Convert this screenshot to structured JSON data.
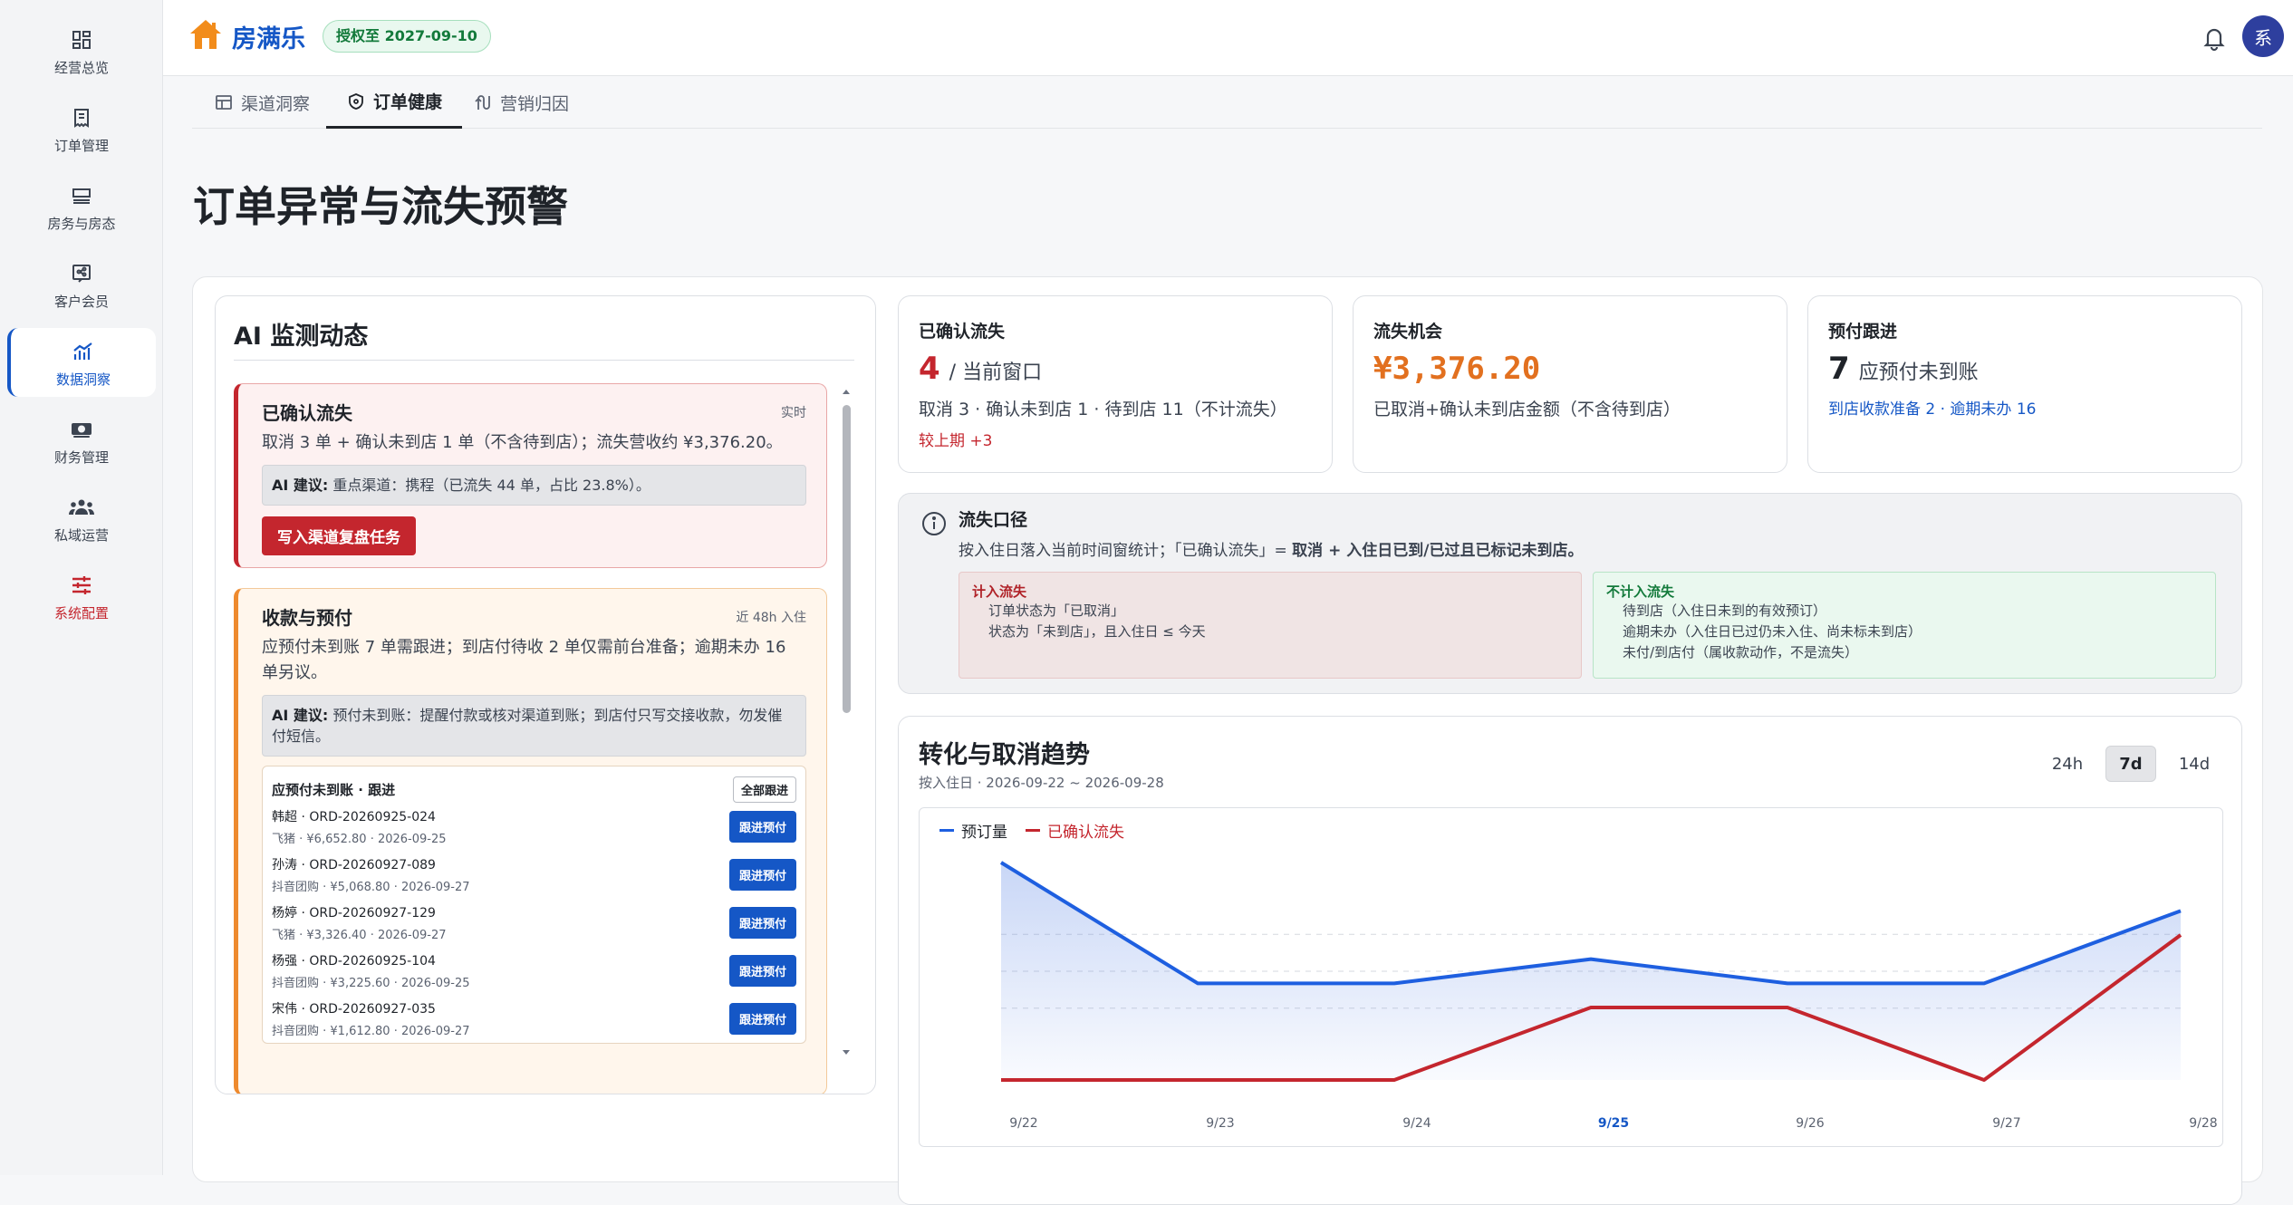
{
  "sidebar": {
    "items": [
      {
        "label": "经营总览",
        "icon": "dashboard-icon"
      },
      {
        "label": "订单管理",
        "icon": "order-icon"
      },
      {
        "label": "房务与房态",
        "icon": "room-icon"
      },
      {
        "label": "客户会员",
        "icon": "member-icon"
      },
      {
        "label": "数据洞察",
        "icon": "chart-icon"
      },
      {
        "label": "财务管理",
        "icon": "cash-icon"
      },
      {
        "label": "私域运营",
        "icon": "community-icon"
      },
      {
        "label": "系统配置",
        "icon": "settings-icon"
      }
    ],
    "active_index": 4
  },
  "header": {
    "brand": "房满乐",
    "license": "授权至 2027-09-10",
    "avatar": "系"
  },
  "tabs": [
    {
      "label": "渠道洞察"
    },
    {
      "label": "订单健康"
    },
    {
      "label": "营销归因"
    }
  ],
  "page_title": "订单异常与流失预警",
  "ai_panel": {
    "title": "AI 监测动态",
    "alerts": [
      {
        "title": "已确认流失",
        "tag": "实时",
        "body": "取消 3 单 + 确认未到店 1 单（不含待到店）；流失营收约 ¥3,376.20。",
        "suggest_label": "AI 建议:",
        "suggest": "重点渠道：携程（已流失 44 单，占比 23.8%）。",
        "action": "写入渠道复盘任务"
      },
      {
        "title": "收款与预付",
        "tag": "近 48h 入住",
        "body": "应预付未到账 7 单需跟进；到店付待收 2 单仅需前台准备；逾期未办 16 单另议。",
        "suggest_label": "AI 建议:",
        "suggest": "预付未到账：提醒付款或核对渠道到账；到店付只写交接收款，勿发催付短信。",
        "follow_title": "应预付未到账 · 跟进",
        "follow_all": "全部跟进",
        "orders": [
          {
            "name": "韩超 · ORD-20260925-024",
            "sub": "飞猪 · ¥6,652.80 · 2026-09-25",
            "action": "跟进预付"
          },
          {
            "name": "孙涛 · ORD-20260927-089",
            "sub": "抖音团购 · ¥5,068.80 · 2026-09-27",
            "action": "跟进预付"
          },
          {
            "name": "杨婷 · ORD-20260927-129",
            "sub": "飞猪 · ¥3,326.40 · 2026-09-27",
            "action": "跟进预付"
          },
          {
            "name": "杨强 · ORD-20260925-104",
            "sub": "抖音团购 · ¥3,225.60 · 2026-09-25",
            "action": "跟进预付"
          },
          {
            "name": "宋伟 · ORD-20260927-035",
            "sub": "抖音团购 · ¥1,612.80 · 2026-09-27",
            "action": "跟进预付"
          }
        ]
      }
    ]
  },
  "kpis": [
    {
      "label": "已确认流失",
      "num": "4",
      "suffix": "/ 当前窗口",
      "sub": "取消 3 · 确认未到店 1 · 待到店 11（不计流失）",
      "sub2": "较上期 +3",
      "num_color": "#c4262e",
      "sub2_color": "#c4262e"
    },
    {
      "label": "流失机会",
      "num": "¥3,376.20",
      "suffix": "",
      "sub": "已取消+确认未到店金额（不含待到店）",
      "sub2": "",
      "num_color": "#e2701f",
      "sub2_color": "#1557c6"
    },
    {
      "label": "预付跟进",
      "num": "7",
      "suffix": "应预付未到账",
      "sub": "",
      "sub2": "到店收款准备 2 · 逾期未办 16",
      "num_color": "#1f2329",
      "sub2_color": "#1557c6"
    }
  ],
  "info": {
    "title": "流失口径",
    "desc_prefix": "按入住日落入当前时间窗统计；「已确认流失」= ",
    "desc_strong": "取消 + 入住日已到/已过且已标记未到店。",
    "in_title": "计入流失",
    "in_lines": [
      "订单状态为「已取消」",
      "状态为「未到店」，且入住日 ≤ 今天"
    ],
    "out_title": "不计入流失",
    "out_lines": [
      "待到店（入住日未到的有效预订）",
      "逾期未办（入住日已过仍未入住、尚未标未到店）",
      "未付/到店付（属收款动作，不是流失）"
    ]
  },
  "trend": {
    "title": "转化与取消趋势",
    "sub": "按入住日 · 2026-09-22 ~ 2026-09-28",
    "ranges": [
      "24h",
      "7d",
      "14d"
    ],
    "active_range": 1
  },
  "chart_data": {
    "type": "line",
    "x": [
      "9/22",
      "9/23",
      "9/24",
      "9/25",
      "9/26",
      "9/27",
      "9/28"
    ],
    "highlight_x": "9/25",
    "series": [
      {
        "name": "预订量",
        "color": "#1e5fe0",
        "values": [
          9,
          4,
          4,
          5,
          4,
          4,
          7
        ]
      },
      {
        "name": "已确认流失",
        "color": "#c4262e",
        "values": [
          0,
          0,
          0,
          3,
          3,
          0,
          6
        ]
      }
    ],
    "ylim": [
      0,
      9
    ]
  }
}
